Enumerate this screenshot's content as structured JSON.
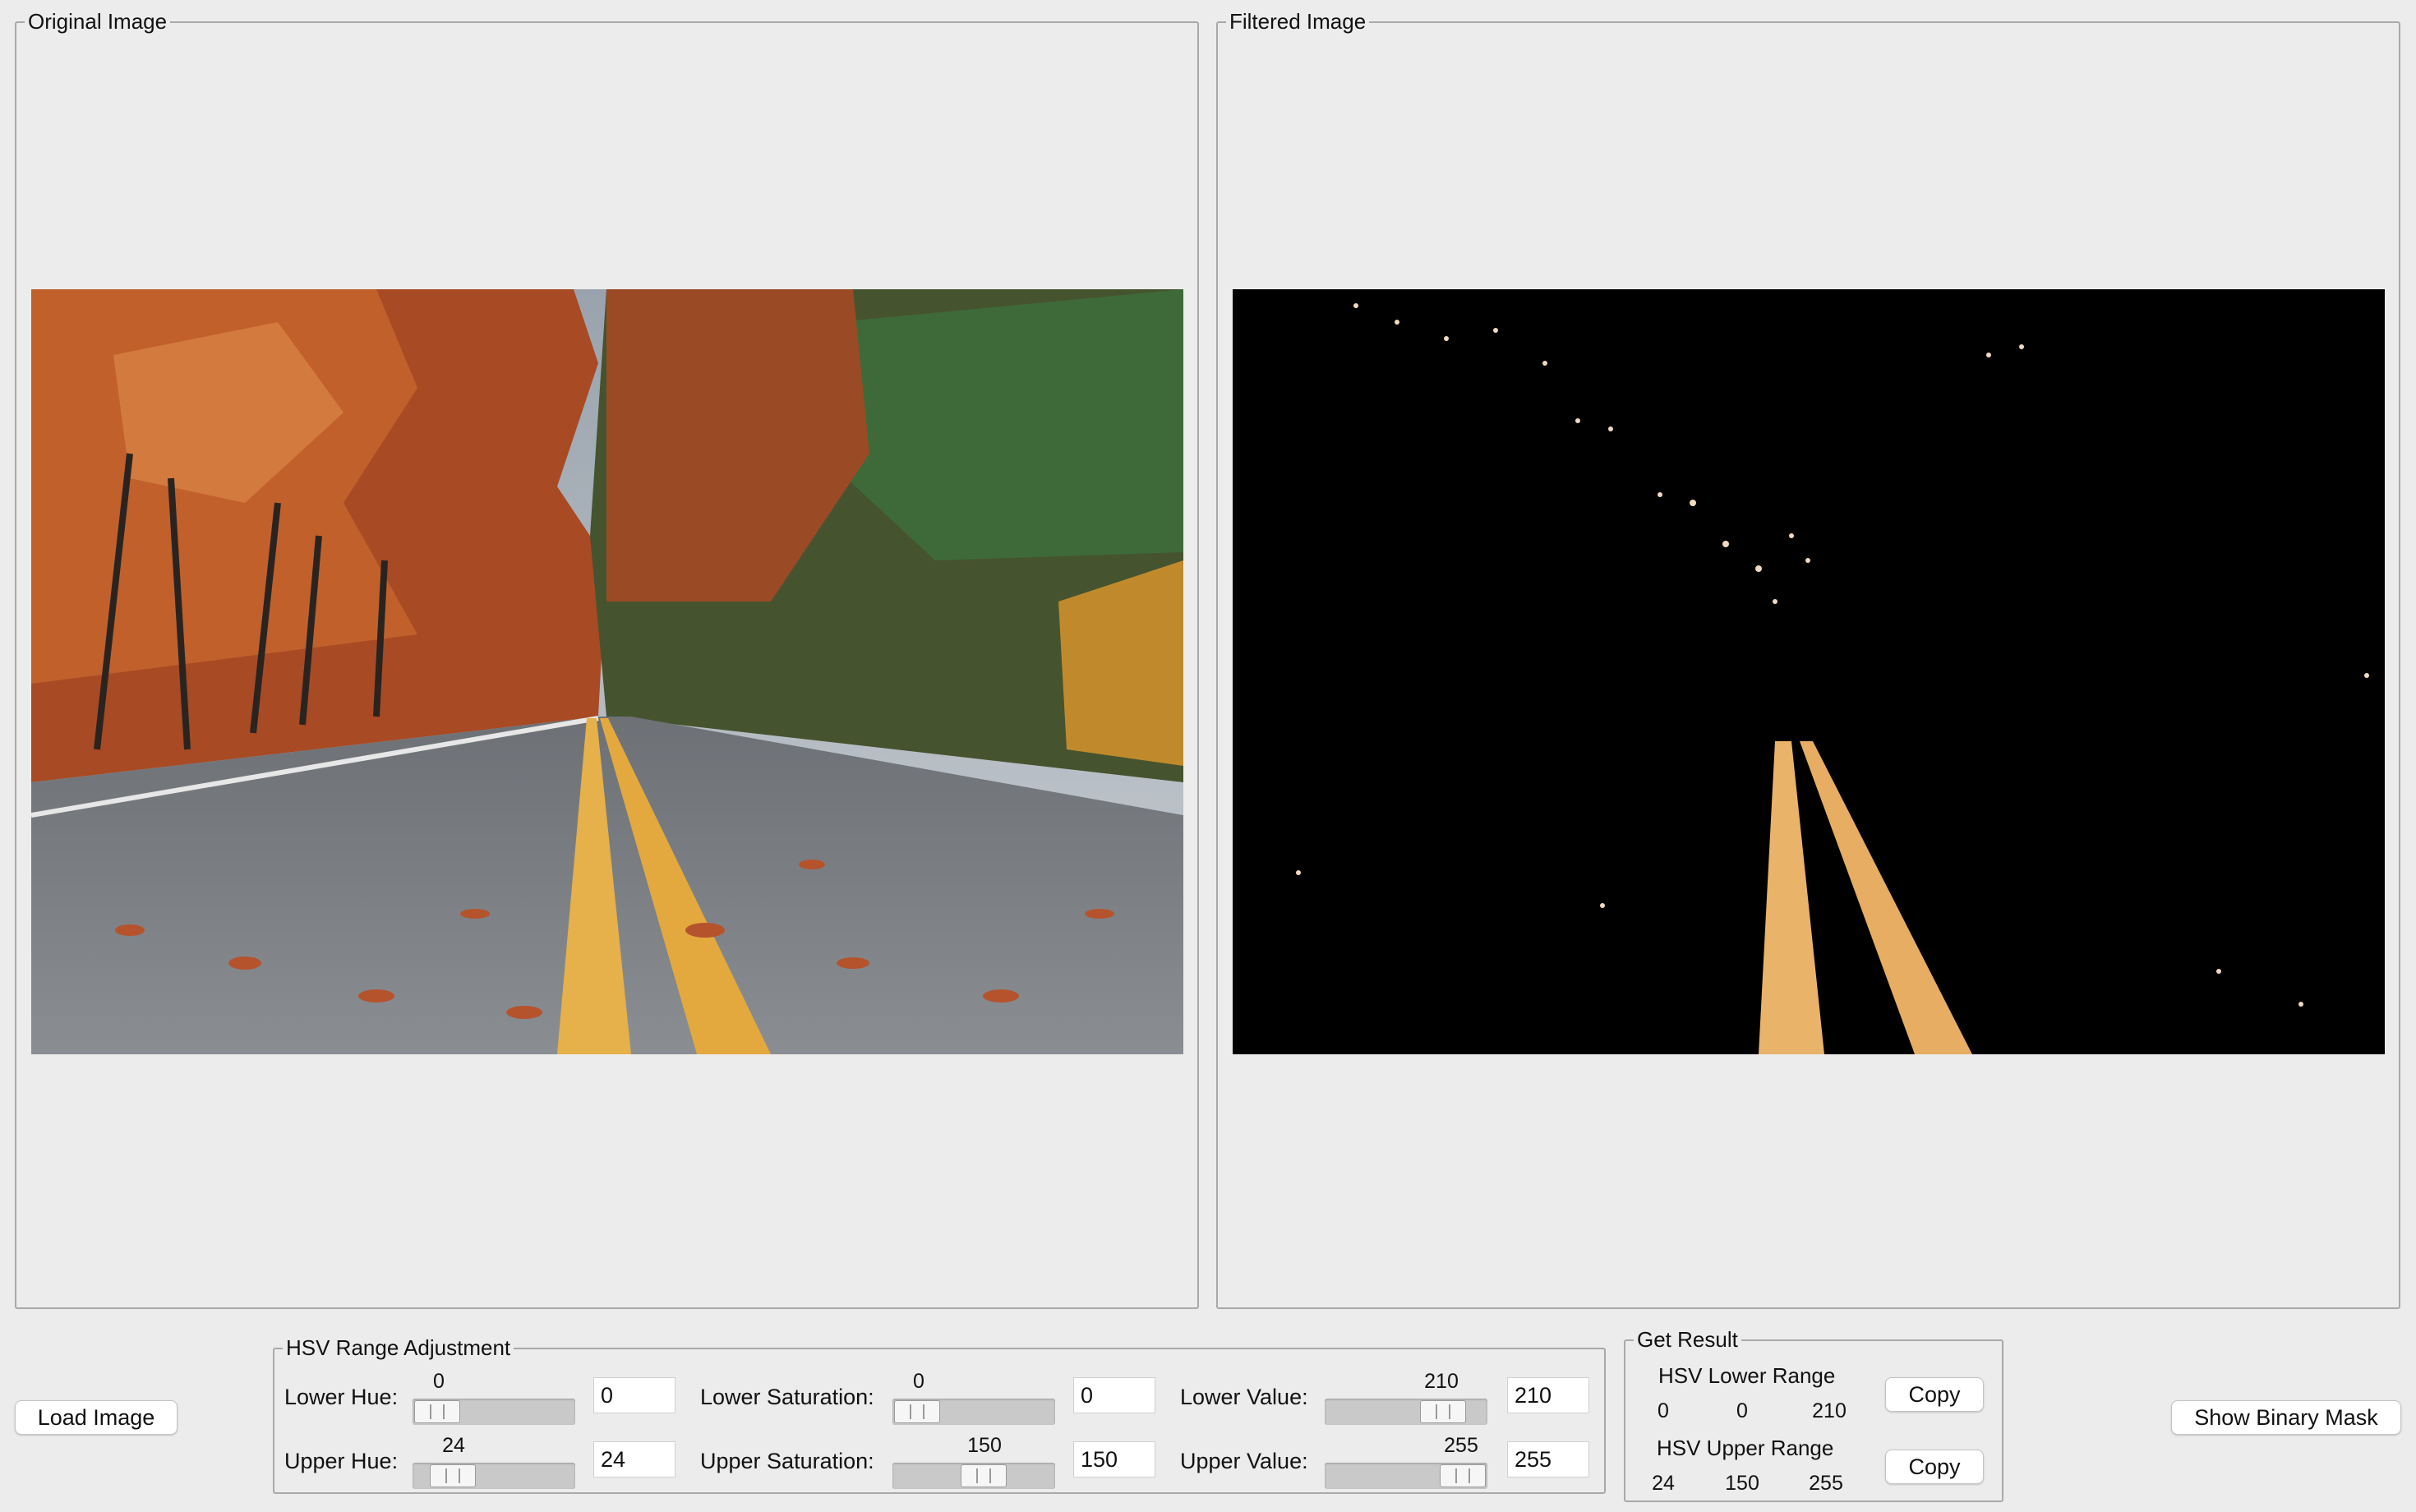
{
  "panels": {
    "original_title": "Original Image",
    "filtered_title": "Filtered Image"
  },
  "buttons": {
    "load_image": "Load Image",
    "show_binary_mask": "Show Binary Mask",
    "copy_lower": "Copy",
    "copy_upper": "Copy"
  },
  "hsv_adjust": {
    "title": "HSV Range Adjustment",
    "lower_hue": {
      "label": "Lower Hue:",
      "value": "0",
      "min": 0,
      "max": 179,
      "level": 0
    },
    "upper_hue": {
      "label": "Upper Hue:",
      "value": "24",
      "min": 0,
      "max": 179,
      "level": 24
    },
    "lower_saturation": {
      "label": "Lower Saturation:",
      "value": "0",
      "min": 0,
      "max": 255,
      "level": 0
    },
    "upper_saturation": {
      "label": "Upper Saturation:",
      "value": "150",
      "min": 0,
      "max": 255,
      "level": 150
    },
    "lower_value": {
      "label": "Lower Value:",
      "value": "210",
      "min": 0,
      "max": 255,
      "level": 210
    },
    "upper_value": {
      "label": "Upper Value:",
      "value": "255",
      "min": 0,
      "max": 255,
      "level": 255
    }
  },
  "result": {
    "title": "Get Result",
    "lower_label": "HSV Lower Range",
    "lower_values": [
      "0",
      "0",
      "210"
    ],
    "upper_label": "HSV Upper Range",
    "upper_values": [
      "24",
      "150",
      "255"
    ]
  }
}
